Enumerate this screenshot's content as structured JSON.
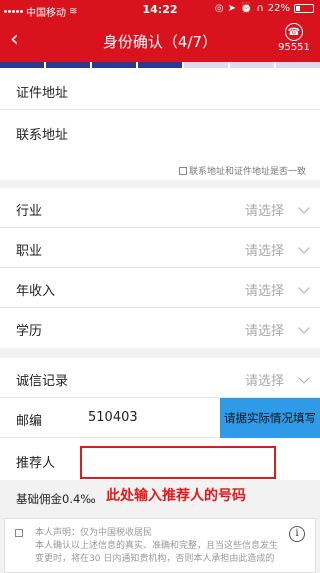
{
  "status_bar": {
    "carrier": "中国移动",
    "time": "14:22",
    "battery": "22%",
    "battery_level": 0.22
  },
  "nav": {
    "back": "‹",
    "title": "身份确认（4/7）",
    "service_number": "95551",
    "service_icon": "headset-icon"
  },
  "progress": {
    "total_steps": 7,
    "current_step": 4
  },
  "fields": {
    "cert_address": "证件地址",
    "contact_address": "联系地址",
    "consistent_label": "联系地址和证件地址是否一致",
    "industry": "行业",
    "occupation": "职业",
    "income": "年收入",
    "education": "学历",
    "credit": "诚信记录",
    "placeholder": "请选择",
    "zip_label": "邮编",
    "zip_value": "510403",
    "zip_note": "请据实际情况填写",
    "referrer_label": "推荐人",
    "commission": "基础佣金0.4‰"
  },
  "annotation": "此处输入推荐人的号码",
  "declaration": {
    "line1": "本人声明：仅为中国税收居民",
    "line2": "本人确认以上述信息的真实、准确和完整，且当这些信息发生变更时，将在30 日内通知贵机构，否则本人承担由此造成的"
  },
  "colors": {
    "brand_red": "#d9131e",
    "progress_done": "#2b3990",
    "progress_todo": "#dcd9f0",
    "note_blue": "#2f9be8",
    "annotation_red": "#e11a1a"
  }
}
